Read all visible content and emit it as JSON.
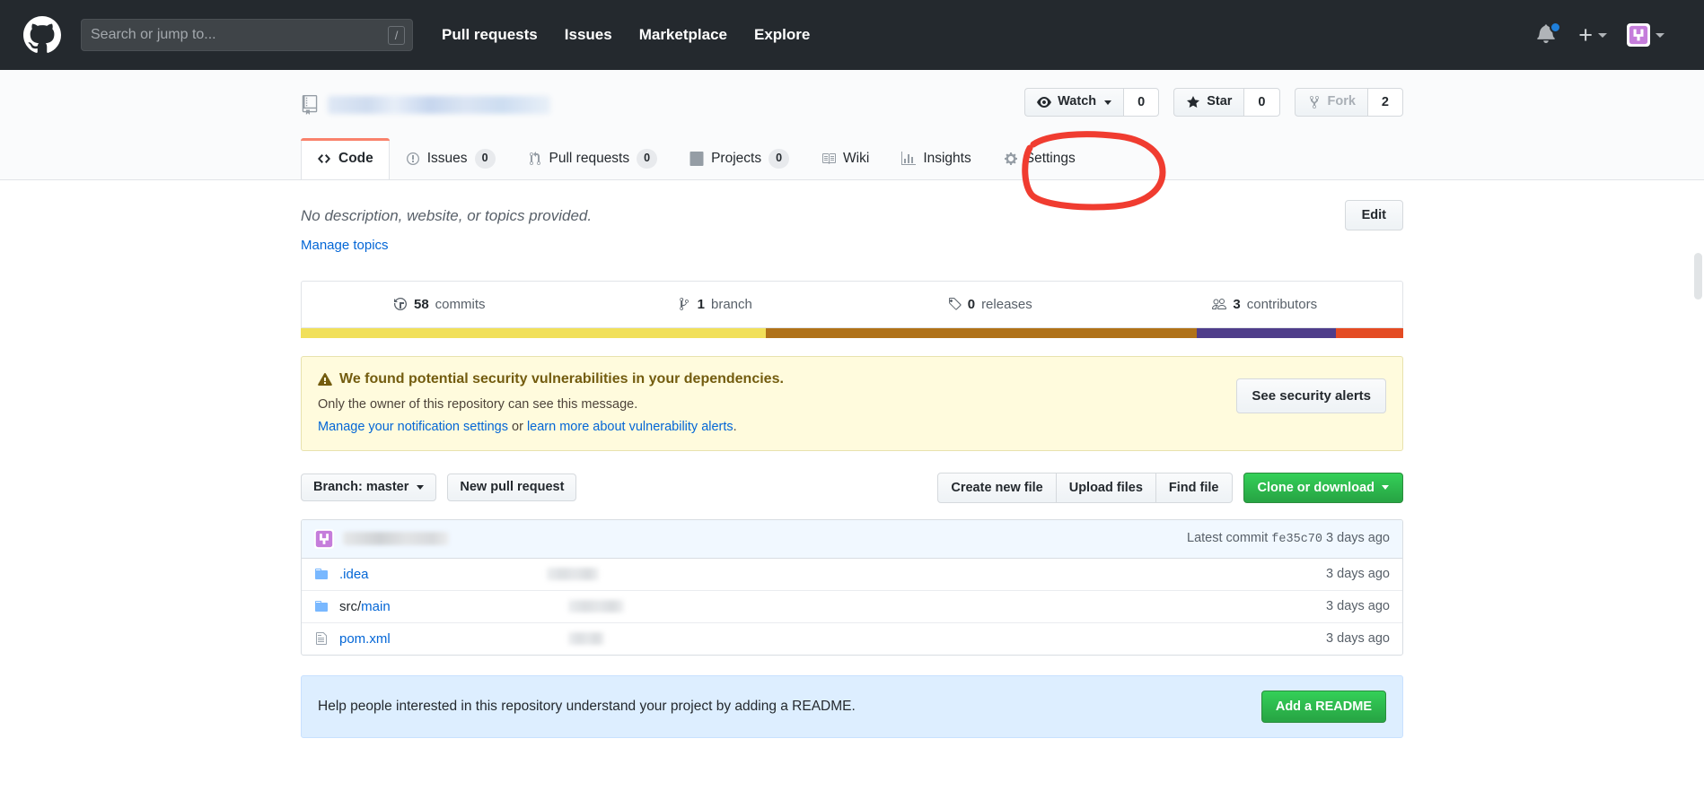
{
  "header": {
    "logo_icon": "github-mark-icon",
    "search": {
      "placeholder": "Search or jump to...",
      "shortcut_key": "/"
    },
    "nav": [
      {
        "label": "Pull requests"
      },
      {
        "label": "Issues"
      },
      {
        "label": "Marketplace"
      },
      {
        "label": "Explore"
      }
    ],
    "notifications_icon": "bell-icon",
    "has_unread": true,
    "create_new_icon": "plus-icon",
    "avatar_icon": "user-avatar-icon"
  },
  "repo": {
    "book_icon": "repository-icon",
    "name_redacted": true,
    "actions": {
      "watch": {
        "label": "Watch",
        "count": "0",
        "icon": "eye-icon"
      },
      "star": {
        "label": "Star",
        "count": "0",
        "icon": "star-icon"
      },
      "fork": {
        "label": "Fork",
        "count": "2",
        "icon": "repo-forked-icon",
        "disabled": true
      }
    },
    "tabs": [
      {
        "label": "Code",
        "icon": "code-icon",
        "count": null,
        "active": true
      },
      {
        "label": "Issues",
        "icon": "issue-opened-icon",
        "count": "0",
        "active": false
      },
      {
        "label": "Pull requests",
        "icon": "git-pull-request-icon",
        "count": "0",
        "active": false
      },
      {
        "label": "Projects",
        "icon": "project-icon",
        "count": "0",
        "active": false
      },
      {
        "label": "Wiki",
        "icon": "book-icon",
        "count": null,
        "active": false
      },
      {
        "label": "Insights",
        "icon": "graph-icon",
        "count": null,
        "active": false
      },
      {
        "label": "Settings",
        "icon": "gear-icon",
        "count": null,
        "active": false
      }
    ]
  },
  "about": {
    "description": "No description, website, or topics provided.",
    "manage_topics_label": "Manage topics",
    "edit_label": "Edit"
  },
  "numbers": [
    {
      "icon": "history-icon",
      "value": "58",
      "label": "commits"
    },
    {
      "icon": "git-branch-icon",
      "value": "1",
      "label": "branch"
    },
    {
      "icon": "tag-icon",
      "value": "0",
      "label": "releases"
    },
    {
      "icon": "people-icon",
      "value": "3",
      "label": "contributors"
    }
  ],
  "language_bar": [
    {
      "color": "#f1e05a",
      "pct": 42.2
    },
    {
      "color": "#b07219",
      "pct": 39.1
    },
    {
      "color": "#4f3d8a",
      "pct": 12.6
    },
    {
      "color": "#e44b23",
      "pct": 6.1
    }
  ],
  "security_alert": {
    "warning_icon": "alert-icon",
    "title": "We found potential security vulnerabilities in your dependencies.",
    "subtitle": "Only the owner of this repository can see this message.",
    "link_1": "Manage your notification settings",
    "between": " or ",
    "link_2": "learn more about vulnerability alerts",
    "period": ".",
    "button_label": "See security alerts"
  },
  "file_toolbar": {
    "branch_label": "Branch: master",
    "new_pr_label": "New pull request",
    "create_new_file_label": "Create new file",
    "upload_files_label": "Upload files",
    "find_file_label": "Find file",
    "clone_label": "Clone or download"
  },
  "latest_commit": {
    "avatar_icon": "user-avatar-icon",
    "author_redacted": true,
    "prefix": "Latest commit",
    "sha": "fe35c70",
    "time": "3 days ago"
  },
  "files": [
    {
      "name": ".idea",
      "type": "directory",
      "icon": "file-directory-icon",
      "message_redacted": true,
      "message_width": 58,
      "time": "3 days ago"
    },
    {
      "name_prefix": "src/",
      "name": "main",
      "type": "directory",
      "icon": "file-directory-icon",
      "message_redacted": true,
      "message_width": 62,
      "time": "3 days ago"
    },
    {
      "name": "pom.xml",
      "type": "file",
      "icon": "file-icon",
      "message_redacted": true,
      "message_width": 40,
      "time": "3 days ago"
    }
  ],
  "readme_prompt": {
    "text": "Help people interested in this repository understand your project by adding a README.",
    "button_label": "Add a README"
  },
  "annotation": {
    "type": "hand-drawn-circle",
    "color": "#f03c30",
    "target": "Settings"
  },
  "colors": {
    "header_bg": "#24292e",
    "accent_link": "#0366d6",
    "active_tab_border": "#f9826c",
    "green_button": "#28a745",
    "alert_bg": "#fffbdd",
    "readme_bg": "#ddeeff"
  }
}
